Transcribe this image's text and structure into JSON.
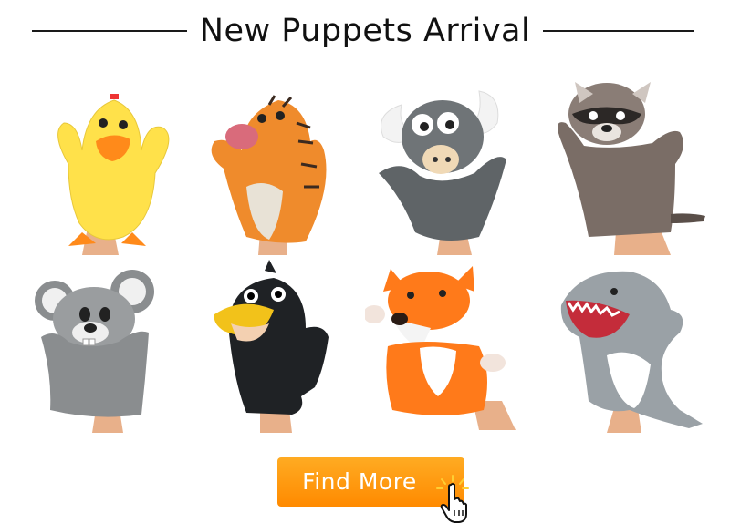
{
  "banner": {
    "title": "New Puppets Arrival"
  },
  "products": [
    {
      "id": "chicken",
      "icon": "chicken-puppet",
      "colors": {
        "body": "#ffe14a",
        "accent": "#ff8a1a"
      }
    },
    {
      "id": "tiger",
      "icon": "tiger-puppet",
      "colors": {
        "body": "#ef8b2c",
        "accent": "#d96b7b"
      }
    },
    {
      "id": "bull",
      "icon": "bull-puppet",
      "colors": {
        "body": "#6f7477",
        "accent": "#f3f3f3"
      }
    },
    {
      "id": "raccoon",
      "icon": "raccoon-puppet",
      "colors": {
        "body": "#7a6d66",
        "accent": "#2c2826"
      }
    },
    {
      "id": "mouse",
      "icon": "mouse-puppet",
      "colors": {
        "body": "#8a8d8f",
        "accent": "#f0f0f0"
      }
    },
    {
      "id": "crow",
      "icon": "crow-puppet",
      "colors": {
        "body": "#1f2225",
        "accent": "#f2c21a"
      }
    },
    {
      "id": "fox",
      "icon": "fox-puppet",
      "colors": {
        "body": "#ff7a1a",
        "accent": "#ffffff"
      }
    },
    {
      "id": "shark",
      "icon": "shark-puppet",
      "colors": {
        "body": "#9aa1a6",
        "accent": "#ffffff"
      }
    }
  ],
  "cta": {
    "label": "Find More",
    "icon": "hand-pointer-icon",
    "color": "#ff9a10"
  }
}
